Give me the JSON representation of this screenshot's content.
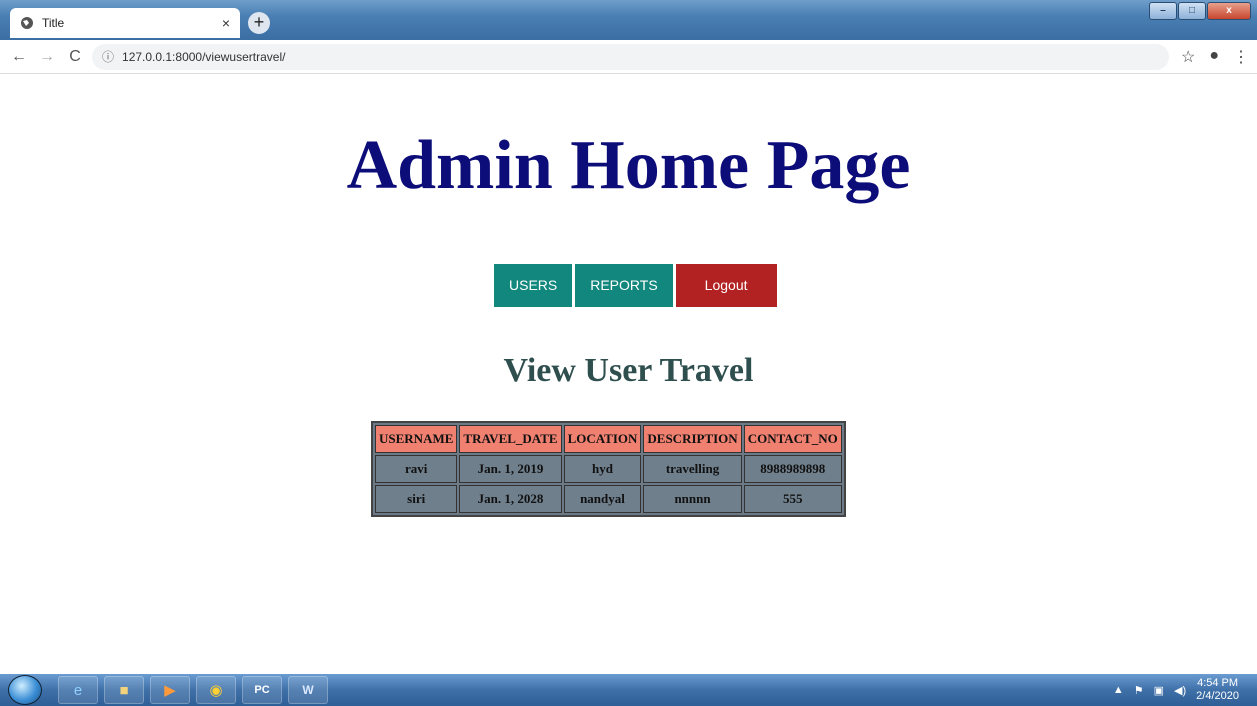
{
  "browser": {
    "tab_title": "Title",
    "tab_close": "×",
    "new_tab": "+",
    "url": "127.0.0.1:8000/viewusertravel/",
    "window_buttons": {
      "minimize": "–",
      "maximize": "□",
      "close": "x"
    }
  },
  "page": {
    "title": "Admin Home Page",
    "nav": {
      "users": "USERS",
      "reports": "REPORTS",
      "logout": "Logout"
    },
    "section_title": "View User Travel",
    "table": {
      "headers": [
        "USERNAME",
        "TRAVEL_DATE",
        "LOCATION",
        "DESCRIPTION",
        "CONTACT_NO"
      ],
      "rows": [
        [
          "ravi",
          "Jan. 1, 2019",
          "hyd",
          "travelling",
          "8988989898"
        ],
        [
          "siri",
          "Jan. 1, 2028",
          "nandyal",
          "nnnnn",
          "555"
        ]
      ]
    }
  },
  "taskbar": {
    "time": "4:54 PM",
    "date": "2/4/2020"
  }
}
